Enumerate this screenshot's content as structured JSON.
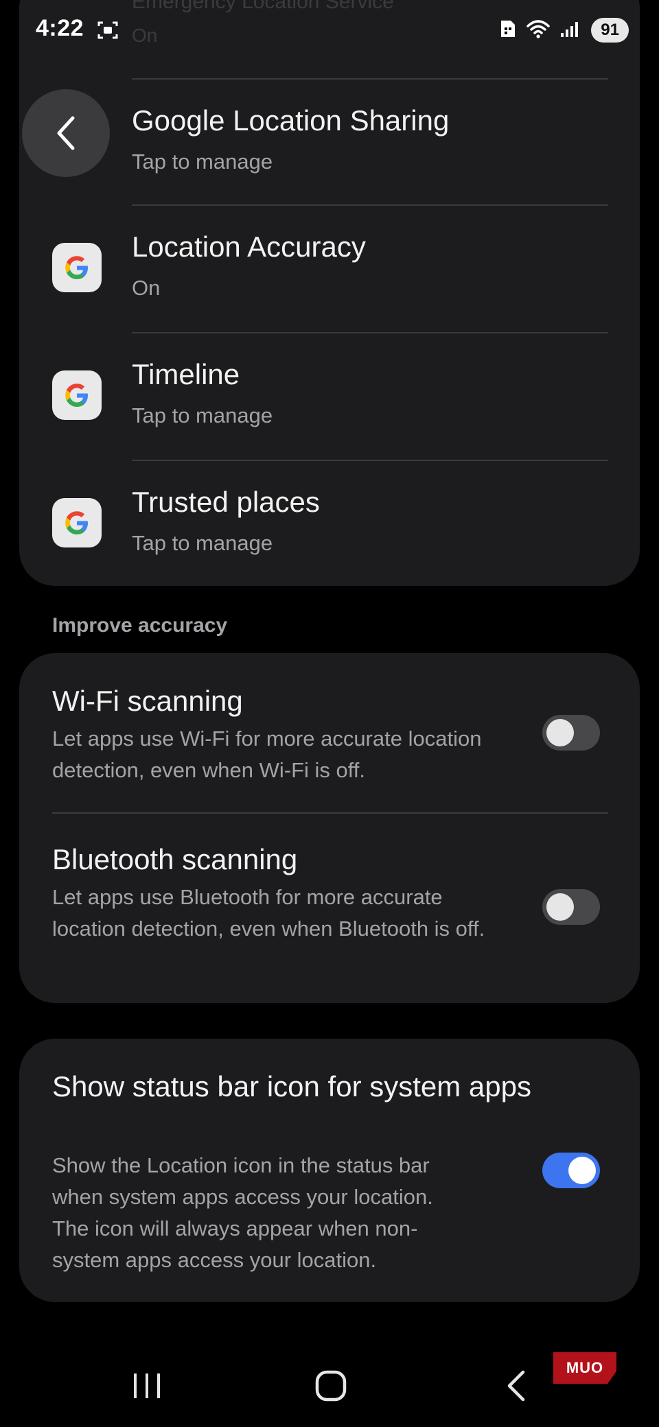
{
  "status_bar": {
    "time": "4:22",
    "battery": "91"
  },
  "ghost_row": {
    "title": "Emergency Location Service",
    "subtitle": "On"
  },
  "location_services": [
    {
      "id": "sharing",
      "title": "Google Location Sharing",
      "subtitle": "Tap to manage",
      "icon": "google-g-icon"
    },
    {
      "id": "accuracy",
      "title": "Location Accuracy",
      "subtitle": "On",
      "icon": "google-g-icon"
    },
    {
      "id": "timeline",
      "title": "Timeline",
      "subtitle": "Tap to manage",
      "icon": "google-g-icon"
    },
    {
      "id": "trusted",
      "title": "Trusted places",
      "subtitle": "Tap to manage",
      "icon": "google-g-icon"
    }
  ],
  "improve_accuracy": {
    "header": "Improve accuracy",
    "wifi": {
      "title": "Wi-Fi scanning",
      "description": "Let apps use Wi-Fi for more accurate location detection, even when Wi-Fi is off.",
      "enabled": false
    },
    "bluetooth": {
      "title": "Bluetooth scanning",
      "description": "Let apps use Bluetooth for more accurate location detection, even when Bluetooth is off.",
      "enabled": false
    }
  },
  "system_apps": {
    "title": "Show status bar icon for system apps",
    "description": "Show the Location icon in the status bar when system apps access your location. The icon will always appear when non-system apps access your location.",
    "enabled": true
  },
  "nav": {
    "recents_icon": "recents-icon",
    "home_icon": "home-icon",
    "back_icon": "back-icon"
  },
  "watermark": "MUO",
  "colors": {
    "background": "#000000",
    "card": "#1c1c1e",
    "accent": "#3d75f0",
    "secondary_text": "#a3a3a8"
  }
}
